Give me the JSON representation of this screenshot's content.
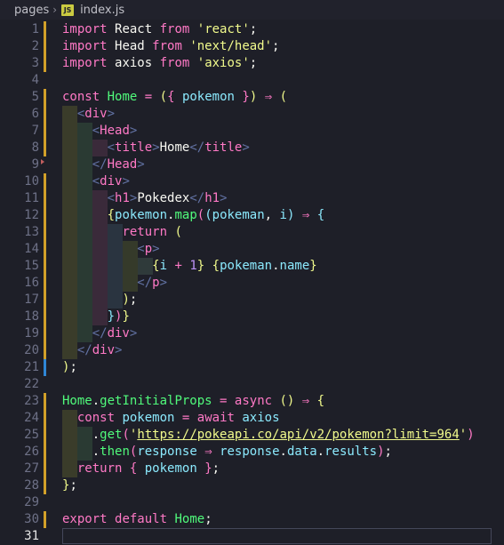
{
  "breadcrumb": {
    "folder": "pages",
    "file_icon_label": "JS",
    "file": "index.js"
  },
  "colors": {
    "background": "#1e1f28",
    "modified_marker": "#d2a029",
    "cursor_line_marker": "#2f86d6"
  },
  "editor": {
    "current_line": 31,
    "lines": [
      {
        "n": "1",
        "marker": "mod",
        "tokens": [
          [
            "k",
            "import"
          ],
          [
            "x",
            " "
          ],
          [
            "b",
            "React"
          ],
          [
            "x",
            " "
          ],
          [
            "k",
            "from"
          ],
          [
            "x",
            " "
          ],
          [
            "s",
            "'react'"
          ],
          [
            "x",
            ";"
          ]
        ]
      },
      {
        "n": "2",
        "marker": "mod",
        "tokens": [
          [
            "k",
            "import"
          ],
          [
            "x",
            " "
          ],
          [
            "b",
            "Head"
          ],
          [
            "x",
            " "
          ],
          [
            "k",
            "from"
          ],
          [
            "x",
            " "
          ],
          [
            "s",
            "'next/head'"
          ],
          [
            "x",
            ";"
          ]
        ]
      },
      {
        "n": "3",
        "marker": "mod",
        "tokens": [
          [
            "k",
            "import"
          ],
          [
            "x",
            " "
          ],
          [
            "b",
            "axios"
          ],
          [
            "x",
            " "
          ],
          [
            "k",
            "from"
          ],
          [
            "x",
            " "
          ],
          [
            "s",
            "'axios'"
          ],
          [
            "x",
            ";"
          ]
        ]
      },
      {
        "n": "4",
        "marker": "",
        "tokens": []
      },
      {
        "n": "5",
        "marker": "mod",
        "tokens": [
          [
            "k",
            "const"
          ],
          [
            "x",
            " "
          ],
          [
            "f",
            "Home"
          ],
          [
            "x",
            " "
          ],
          [
            "k",
            "="
          ],
          [
            "x",
            " "
          ],
          [
            "br1",
            "("
          ],
          [
            "br2",
            "{"
          ],
          [
            "x",
            " "
          ],
          [
            "c",
            "pokemon"
          ],
          [
            "x",
            " "
          ],
          [
            "br2",
            "}"
          ],
          [
            "br1",
            ")"
          ],
          [
            "x",
            " "
          ],
          [
            "k",
            "⇒"
          ],
          [
            "x",
            " "
          ],
          [
            "br1",
            "("
          ]
        ]
      },
      {
        "n": "6",
        "marker": "mod",
        "indent": 1,
        "tokens": [
          [
            "x",
            "  "
          ],
          [
            "p",
            "<"
          ],
          [
            "t",
            "div"
          ],
          [
            "p",
            ">"
          ]
        ]
      },
      {
        "n": "7",
        "marker": "mod",
        "indent": 2,
        "tokens": [
          [
            "x",
            "    "
          ],
          [
            "p",
            "<"
          ],
          [
            "t",
            "Head"
          ],
          [
            "p",
            ">"
          ]
        ]
      },
      {
        "n": "8",
        "marker": "mod",
        "indent": 3,
        "tokens": [
          [
            "x",
            "      "
          ],
          [
            "p",
            "<"
          ],
          [
            "t",
            "title"
          ],
          [
            "p",
            ">"
          ],
          [
            "x",
            "Home"
          ],
          [
            "p",
            "</"
          ],
          [
            "t",
            "title"
          ],
          [
            "p",
            ">"
          ]
        ]
      },
      {
        "n": "9",
        "marker": "",
        "fold": true,
        "indent": 2,
        "tokens": [
          [
            "x",
            "    "
          ],
          [
            "p",
            "</"
          ],
          [
            "t",
            "Head"
          ],
          [
            "p",
            ">"
          ]
        ]
      },
      {
        "n": "10",
        "marker": "mod",
        "indent": 2,
        "tokens": [
          [
            "x",
            "    "
          ],
          [
            "p",
            "<"
          ],
          [
            "t",
            "div"
          ],
          [
            "p",
            ">"
          ]
        ]
      },
      {
        "n": "11",
        "marker": "mod",
        "indent": 3,
        "tokens": [
          [
            "x",
            "      "
          ],
          [
            "p",
            "<"
          ],
          [
            "t",
            "h1"
          ],
          [
            "p",
            ">"
          ],
          [
            "x",
            "Pokedex"
          ],
          [
            "p",
            "</"
          ],
          [
            "t",
            "h1"
          ],
          [
            "p",
            ">"
          ]
        ]
      },
      {
        "n": "12",
        "marker": "mod",
        "indent": 3,
        "tokens": [
          [
            "x",
            "      "
          ],
          [
            "br1",
            "{"
          ],
          [
            "c",
            "pokemon"
          ],
          [
            "x",
            "."
          ],
          [
            "f",
            "map"
          ],
          [
            "br2",
            "("
          ],
          [
            "br3",
            "("
          ],
          [
            "c",
            "pokeman"
          ],
          [
            "x",
            ", "
          ],
          [
            "c",
            "i"
          ],
          [
            "br3",
            ")"
          ],
          [
            "x",
            " "
          ],
          [
            "k",
            "⇒"
          ],
          [
            "x",
            " "
          ],
          [
            "br3",
            "{"
          ]
        ]
      },
      {
        "n": "13",
        "marker": "mod",
        "indent": 4,
        "tokens": [
          [
            "x",
            "        "
          ],
          [
            "k",
            "return"
          ],
          [
            "x",
            " "
          ],
          [
            "br1",
            "("
          ]
        ]
      },
      {
        "n": "14",
        "marker": "mod",
        "indent": 5,
        "tokens": [
          [
            "x",
            "          "
          ],
          [
            "p",
            "<"
          ],
          [
            "t",
            "p"
          ],
          [
            "p",
            ">"
          ]
        ]
      },
      {
        "n": "15",
        "marker": "mod",
        "indent": 6,
        "tokens": [
          [
            "x",
            "            "
          ],
          [
            "br1",
            "{"
          ],
          [
            "c",
            "i"
          ],
          [
            "x",
            " "
          ],
          [
            "k",
            "+"
          ],
          [
            "x",
            " "
          ],
          [
            "n",
            "1"
          ],
          [
            "br1",
            "}"
          ],
          [
            "x",
            " "
          ],
          [
            "br1",
            "{"
          ],
          [
            "c",
            "pokeman"
          ],
          [
            "x",
            "."
          ],
          [
            "c",
            "name"
          ],
          [
            "br1",
            "}"
          ]
        ]
      },
      {
        "n": "16",
        "marker": "mod",
        "indent": 5,
        "tokens": [
          [
            "x",
            "          "
          ],
          [
            "p",
            "</"
          ],
          [
            "t",
            "p"
          ],
          [
            "p",
            ">"
          ]
        ]
      },
      {
        "n": "17",
        "marker": "mod",
        "indent": 4,
        "tokens": [
          [
            "x",
            "        "
          ],
          [
            "br1",
            ")"
          ],
          [
            "x",
            ";"
          ]
        ]
      },
      {
        "n": "18",
        "marker": "mod",
        "indent": 3,
        "tokens": [
          [
            "x",
            "      "
          ],
          [
            "br3",
            "}"
          ],
          [
            "br2",
            ")"
          ],
          [
            "br1",
            "}"
          ]
        ]
      },
      {
        "n": "19",
        "marker": "mod",
        "indent": 2,
        "tokens": [
          [
            "x",
            "    "
          ],
          [
            "p",
            "</"
          ],
          [
            "t",
            "div"
          ],
          [
            "p",
            ">"
          ]
        ]
      },
      {
        "n": "20",
        "marker": "mod",
        "indent": 1,
        "tokens": [
          [
            "x",
            "  "
          ],
          [
            "p",
            "</"
          ],
          [
            "t",
            "div"
          ],
          [
            "p",
            ">"
          ]
        ]
      },
      {
        "n": "21",
        "marker": "cur",
        "tokens": [
          [
            "br1",
            ")"
          ],
          [
            "x",
            ";"
          ]
        ]
      },
      {
        "n": "22",
        "marker": "",
        "tokens": []
      },
      {
        "n": "23",
        "marker": "mod",
        "tokens": [
          [
            "f",
            "Home"
          ],
          [
            "x",
            "."
          ],
          [
            "f",
            "getInitialProps"
          ],
          [
            "x",
            " "
          ],
          [
            "k",
            "="
          ],
          [
            "x",
            " "
          ],
          [
            "k",
            "async"
          ],
          [
            "x",
            " "
          ],
          [
            "br1",
            "()"
          ],
          [
            "x",
            " "
          ],
          [
            "k",
            "⇒"
          ],
          [
            "x",
            " "
          ],
          [
            "br1",
            "{"
          ]
        ]
      },
      {
        "n": "24",
        "marker": "mod",
        "indent": 1,
        "tokens": [
          [
            "x",
            "  "
          ],
          [
            "k",
            "const"
          ],
          [
            "x",
            " "
          ],
          [
            "c",
            "pokemon"
          ],
          [
            "x",
            " "
          ],
          [
            "k",
            "="
          ],
          [
            "x",
            " "
          ],
          [
            "k",
            "await"
          ],
          [
            "x",
            " "
          ],
          [
            "c",
            "axios"
          ]
        ]
      },
      {
        "n": "25",
        "marker": "mod",
        "indent": 2,
        "tokens": [
          [
            "x",
            "    ."
          ],
          [
            "f",
            "get"
          ],
          [
            "br2",
            "("
          ],
          [
            "s",
            "'"
          ],
          [
            "u",
            "https://pokeapi.co/api/v2/pokemon?limit=964"
          ],
          [
            "s",
            "'"
          ],
          [
            "br2",
            ")"
          ]
        ]
      },
      {
        "n": "26",
        "marker": "mod",
        "indent": 2,
        "tokens": [
          [
            "x",
            "    ."
          ],
          [
            "f",
            "then"
          ],
          [
            "br2",
            "("
          ],
          [
            "c",
            "response"
          ],
          [
            "x",
            " "
          ],
          [
            "k",
            "⇒"
          ],
          [
            "x",
            " "
          ],
          [
            "c",
            "response"
          ],
          [
            "x",
            "."
          ],
          [
            "c",
            "data"
          ],
          [
            "x",
            "."
          ],
          [
            "c",
            "results"
          ],
          [
            "br2",
            ")"
          ],
          [
            "x",
            ";"
          ]
        ]
      },
      {
        "n": "27",
        "marker": "mod",
        "indent": 1,
        "tokens": [
          [
            "x",
            "  "
          ],
          [
            "k",
            "return"
          ],
          [
            "x",
            " "
          ],
          [
            "br2",
            "{"
          ],
          [
            "x",
            " "
          ],
          [
            "c",
            "pokemon"
          ],
          [
            "x",
            " "
          ],
          [
            "br2",
            "}"
          ],
          [
            "x",
            ";"
          ]
        ]
      },
      {
        "n": "28",
        "marker": "mod",
        "tokens": [
          [
            "br1",
            "}"
          ],
          [
            "x",
            ";"
          ]
        ]
      },
      {
        "n": "29",
        "marker": "",
        "tokens": []
      },
      {
        "n": "30",
        "marker": "mod",
        "tokens": [
          [
            "k",
            "export"
          ],
          [
            "x",
            " "
          ],
          [
            "k",
            "default"
          ],
          [
            "x",
            " "
          ],
          [
            "f",
            "Home"
          ],
          [
            "x",
            ";"
          ]
        ]
      },
      {
        "n": "31",
        "marker": "",
        "tokens": []
      }
    ]
  }
}
